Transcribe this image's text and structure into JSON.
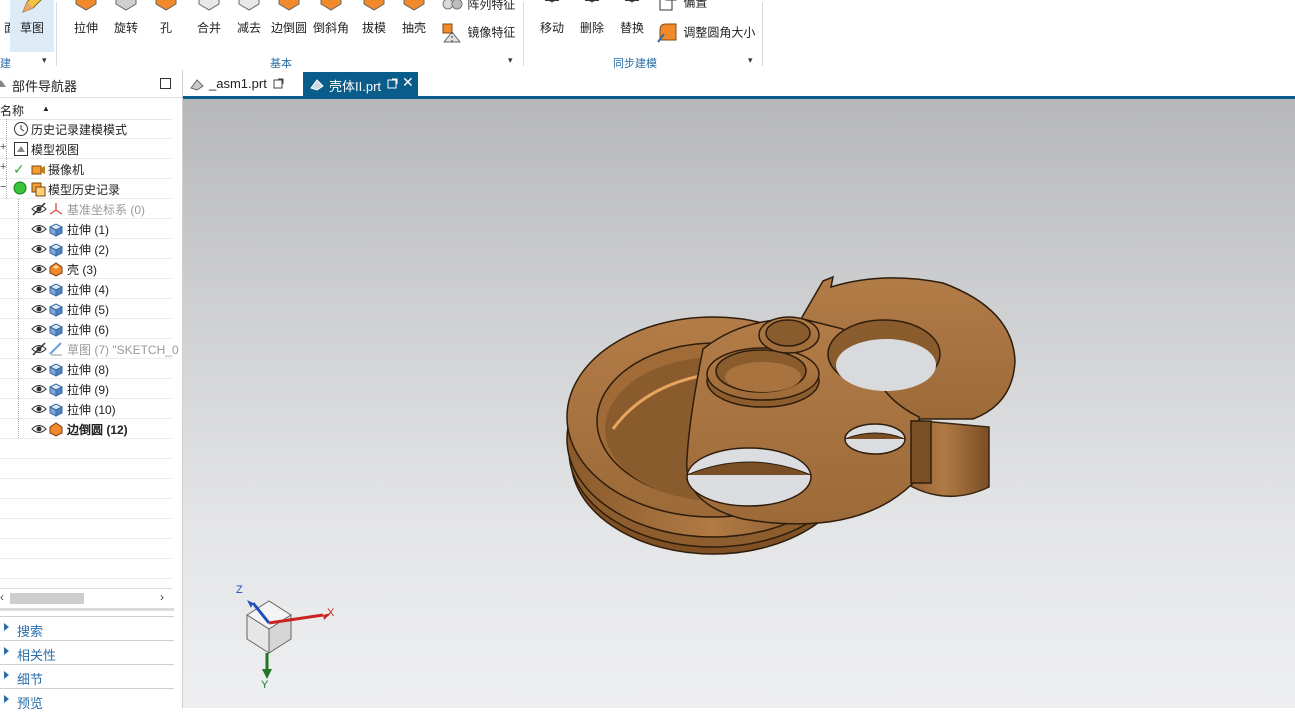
{
  "ribbon": {
    "partial_left_label": "面",
    "sketch_label": "草图",
    "partial_group_label": "建",
    "basic_buttons": [
      "拉伸",
      "旋转",
      "孔",
      "合并",
      "减去",
      "边倒圆",
      "倒斜角",
      "拔模",
      "抽壳"
    ],
    "pattern_feature_label": "阵列特征",
    "mirror_feature_label": "镜像特征",
    "basic_group_label": "基本",
    "sync_buttons": [
      "移动",
      "删除",
      "替换"
    ],
    "offset_label": "偏置",
    "resize_blend_label": "调整圆角大小",
    "sync_group_label": "同步建模"
  },
  "navigator": {
    "title": "部件导航器",
    "column_name": "名称",
    "rows": [
      {
        "label": "历史记录建模模式",
        "icon": "clock-icon",
        "dim": false,
        "bold": false
      },
      {
        "label": "模型视图",
        "icon": "model-views-icon",
        "dim": false,
        "bold": false
      },
      {
        "label": "摄像机",
        "icon": "camera-icon",
        "dim": false,
        "bold": false
      },
      {
        "label": "模型历史记录",
        "icon": "model-history-icon",
        "dim": false,
        "bold": false
      },
      {
        "label": "基准坐标系 (0)",
        "icon": "datum-csys-icon",
        "dim": true,
        "bold": false
      },
      {
        "label": "拉伸 (1)",
        "icon": "extrude-icon",
        "dim": false,
        "bold": false
      },
      {
        "label": "拉伸 (2)",
        "icon": "extrude-icon",
        "dim": false,
        "bold": false
      },
      {
        "label": "壳 (3)",
        "icon": "shell-icon",
        "dim": false,
        "bold": false
      },
      {
        "label": "拉伸 (4)",
        "icon": "extrude-icon",
        "dim": false,
        "bold": false
      },
      {
        "label": "拉伸 (5)",
        "icon": "extrude-icon",
        "dim": false,
        "bold": false
      },
      {
        "label": "拉伸 (6)",
        "icon": "extrude-icon",
        "dim": false,
        "bold": false
      },
      {
        "label": "草图 (7) \"SKETCH_0",
        "icon": "sketch-icon",
        "dim": true,
        "bold": false
      },
      {
        "label": "拉伸 (8)",
        "icon": "extrude-icon",
        "dim": false,
        "bold": false
      },
      {
        "label": "拉伸 (9)",
        "icon": "extrude-icon",
        "dim": false,
        "bold": false
      },
      {
        "label": "拉伸 (10)",
        "icon": "extrude-icon",
        "dim": false,
        "bold": false
      },
      {
        "label": "边倒圆 (12)",
        "icon": "edge-blend-icon",
        "dim": false,
        "bold": true
      }
    ],
    "panels": [
      "搜索",
      "相关性",
      "细节",
      "预览"
    ]
  },
  "tabs": [
    {
      "label": "_asm1.prt",
      "active": false
    },
    {
      "label": "壳体II.prt",
      "active": true
    }
  ],
  "triad": {
    "x_label": "X",
    "y_label": "Y",
    "z_label": "Z"
  },
  "colors": {
    "accent": "#0a5c8a",
    "part": "#a9733f",
    "link": "#2a6ea8"
  }
}
